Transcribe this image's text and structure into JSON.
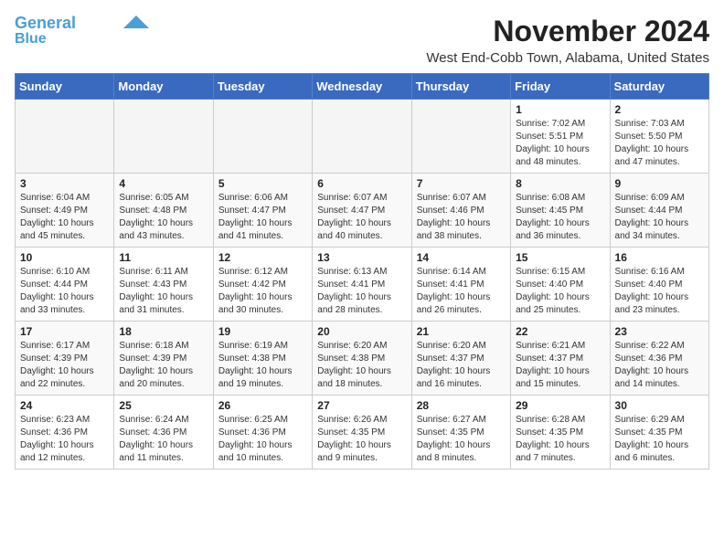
{
  "logo": {
    "line1": "General",
    "line2": "Blue"
  },
  "header": {
    "month": "November 2024",
    "location": "West End-Cobb Town, Alabama, United States"
  },
  "days_of_week": [
    "Sunday",
    "Monday",
    "Tuesday",
    "Wednesday",
    "Thursday",
    "Friday",
    "Saturday"
  ],
  "weeks": [
    [
      {
        "day": "",
        "empty": true
      },
      {
        "day": "",
        "empty": true
      },
      {
        "day": "",
        "empty": true
      },
      {
        "day": "",
        "empty": true
      },
      {
        "day": "",
        "empty": true
      },
      {
        "day": "1",
        "info": "Sunrise: 7:02 AM\nSunset: 5:51 PM\nDaylight: 10 hours\nand 48 minutes."
      },
      {
        "day": "2",
        "info": "Sunrise: 7:03 AM\nSunset: 5:50 PM\nDaylight: 10 hours\nand 47 minutes."
      }
    ],
    [
      {
        "day": "3",
        "info": "Sunrise: 6:04 AM\nSunset: 4:49 PM\nDaylight: 10 hours\nand 45 minutes."
      },
      {
        "day": "4",
        "info": "Sunrise: 6:05 AM\nSunset: 4:48 PM\nDaylight: 10 hours\nand 43 minutes."
      },
      {
        "day": "5",
        "info": "Sunrise: 6:06 AM\nSunset: 4:47 PM\nDaylight: 10 hours\nand 41 minutes."
      },
      {
        "day": "6",
        "info": "Sunrise: 6:07 AM\nSunset: 4:47 PM\nDaylight: 10 hours\nand 40 minutes."
      },
      {
        "day": "7",
        "info": "Sunrise: 6:07 AM\nSunset: 4:46 PM\nDaylight: 10 hours\nand 38 minutes."
      },
      {
        "day": "8",
        "info": "Sunrise: 6:08 AM\nSunset: 4:45 PM\nDaylight: 10 hours\nand 36 minutes."
      },
      {
        "day": "9",
        "info": "Sunrise: 6:09 AM\nSunset: 4:44 PM\nDaylight: 10 hours\nand 34 minutes."
      }
    ],
    [
      {
        "day": "10",
        "info": "Sunrise: 6:10 AM\nSunset: 4:44 PM\nDaylight: 10 hours\nand 33 minutes."
      },
      {
        "day": "11",
        "info": "Sunrise: 6:11 AM\nSunset: 4:43 PM\nDaylight: 10 hours\nand 31 minutes."
      },
      {
        "day": "12",
        "info": "Sunrise: 6:12 AM\nSunset: 4:42 PM\nDaylight: 10 hours\nand 30 minutes."
      },
      {
        "day": "13",
        "info": "Sunrise: 6:13 AM\nSunset: 4:41 PM\nDaylight: 10 hours\nand 28 minutes."
      },
      {
        "day": "14",
        "info": "Sunrise: 6:14 AM\nSunset: 4:41 PM\nDaylight: 10 hours\nand 26 minutes."
      },
      {
        "day": "15",
        "info": "Sunrise: 6:15 AM\nSunset: 4:40 PM\nDaylight: 10 hours\nand 25 minutes."
      },
      {
        "day": "16",
        "info": "Sunrise: 6:16 AM\nSunset: 4:40 PM\nDaylight: 10 hours\nand 23 minutes."
      }
    ],
    [
      {
        "day": "17",
        "info": "Sunrise: 6:17 AM\nSunset: 4:39 PM\nDaylight: 10 hours\nand 22 minutes."
      },
      {
        "day": "18",
        "info": "Sunrise: 6:18 AM\nSunset: 4:39 PM\nDaylight: 10 hours\nand 20 minutes."
      },
      {
        "day": "19",
        "info": "Sunrise: 6:19 AM\nSunset: 4:38 PM\nDaylight: 10 hours\nand 19 minutes."
      },
      {
        "day": "20",
        "info": "Sunrise: 6:20 AM\nSunset: 4:38 PM\nDaylight: 10 hours\nand 18 minutes."
      },
      {
        "day": "21",
        "info": "Sunrise: 6:20 AM\nSunset: 4:37 PM\nDaylight: 10 hours\nand 16 minutes."
      },
      {
        "day": "22",
        "info": "Sunrise: 6:21 AM\nSunset: 4:37 PM\nDaylight: 10 hours\nand 15 minutes."
      },
      {
        "day": "23",
        "info": "Sunrise: 6:22 AM\nSunset: 4:36 PM\nDaylight: 10 hours\nand 14 minutes."
      }
    ],
    [
      {
        "day": "24",
        "info": "Sunrise: 6:23 AM\nSunset: 4:36 PM\nDaylight: 10 hours\nand 12 minutes."
      },
      {
        "day": "25",
        "info": "Sunrise: 6:24 AM\nSunset: 4:36 PM\nDaylight: 10 hours\nand 11 minutes."
      },
      {
        "day": "26",
        "info": "Sunrise: 6:25 AM\nSunset: 4:36 PM\nDaylight: 10 hours\nand 10 minutes."
      },
      {
        "day": "27",
        "info": "Sunrise: 6:26 AM\nSunset: 4:35 PM\nDaylight: 10 hours\nand 9 minutes."
      },
      {
        "day": "28",
        "info": "Sunrise: 6:27 AM\nSunset: 4:35 PM\nDaylight: 10 hours\nand 8 minutes."
      },
      {
        "day": "29",
        "info": "Sunrise: 6:28 AM\nSunset: 4:35 PM\nDaylight: 10 hours\nand 7 minutes."
      },
      {
        "day": "30",
        "info": "Sunrise: 6:29 AM\nSunset: 4:35 PM\nDaylight: 10 hours\nand 6 minutes."
      }
    ]
  ]
}
